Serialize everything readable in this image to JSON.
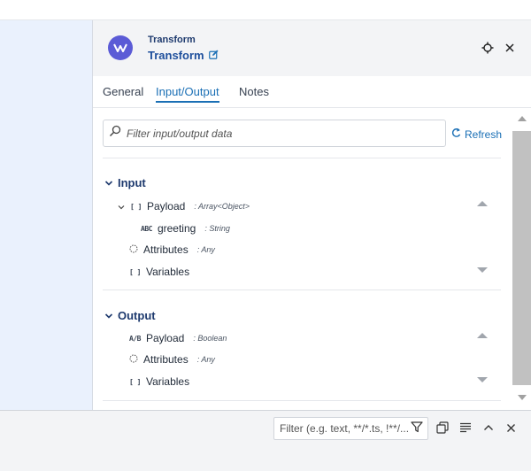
{
  "panel": {
    "subtitle": "Transform",
    "title": "Transform"
  },
  "tabs": [
    {
      "label": "General"
    },
    {
      "label": "Input/Output"
    },
    {
      "label": "Notes"
    }
  ],
  "filter": {
    "placeholder": "Filter input/output data",
    "refresh_label": "Refresh"
  },
  "input": {
    "header": "Input",
    "payload": {
      "label": "Payload",
      "type": ": Array<Object>"
    },
    "greeting": {
      "label": "greeting",
      "type": ": String"
    },
    "attributes": {
      "label": "Attributes",
      "type": ": Any"
    },
    "variables": {
      "label": "Variables"
    }
  },
  "output": {
    "header": "Output",
    "payload": {
      "label": "Payload",
      "type": ": Boolean"
    },
    "attributes": {
      "label": "Attributes",
      "type": ": Any"
    },
    "variables": {
      "label": "Variables"
    }
  },
  "bottom": {
    "filter_placeholder": "Filter (e.g. text, **/*.ts, !**/..."
  },
  "icons": {
    "array": "[ ]",
    "string": "ABC",
    "boolean": "A/B"
  }
}
